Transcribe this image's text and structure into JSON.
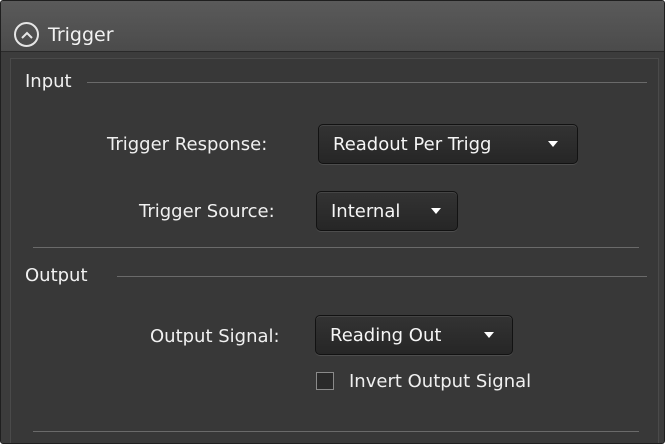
{
  "header": {
    "title": "Trigger",
    "collapse_icon": "chevron-up-icon"
  },
  "input_section": {
    "title": "Input",
    "trigger_response": {
      "label": "Trigger Response:",
      "value": "Readout Per Trigg"
    },
    "trigger_source": {
      "label": "Trigger Source:",
      "value": "Internal"
    }
  },
  "output_section": {
    "title": "Output",
    "output_signal": {
      "label": "Output Signal:",
      "value": "Reading Out"
    },
    "invert": {
      "label": "Invert Output Signal",
      "checked": false
    }
  },
  "colors": {
    "panel_bg": "#3c3c3c",
    "header_bg": "#505050",
    "text": "#f0f0f0"
  }
}
